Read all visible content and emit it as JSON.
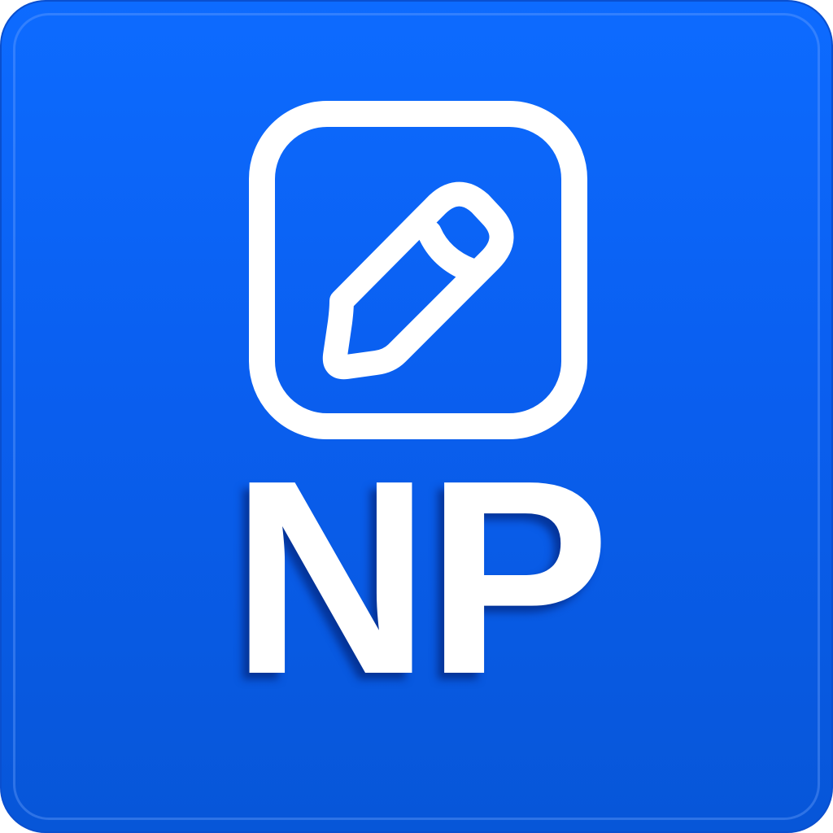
{
  "icon": {
    "glyph": "pencil-square-edit-icon",
    "monogram": "NP",
    "colors": {
      "background_top": "#0d6bff",
      "background_bottom": "#0756d8",
      "foreground": "#ffffff"
    }
  }
}
